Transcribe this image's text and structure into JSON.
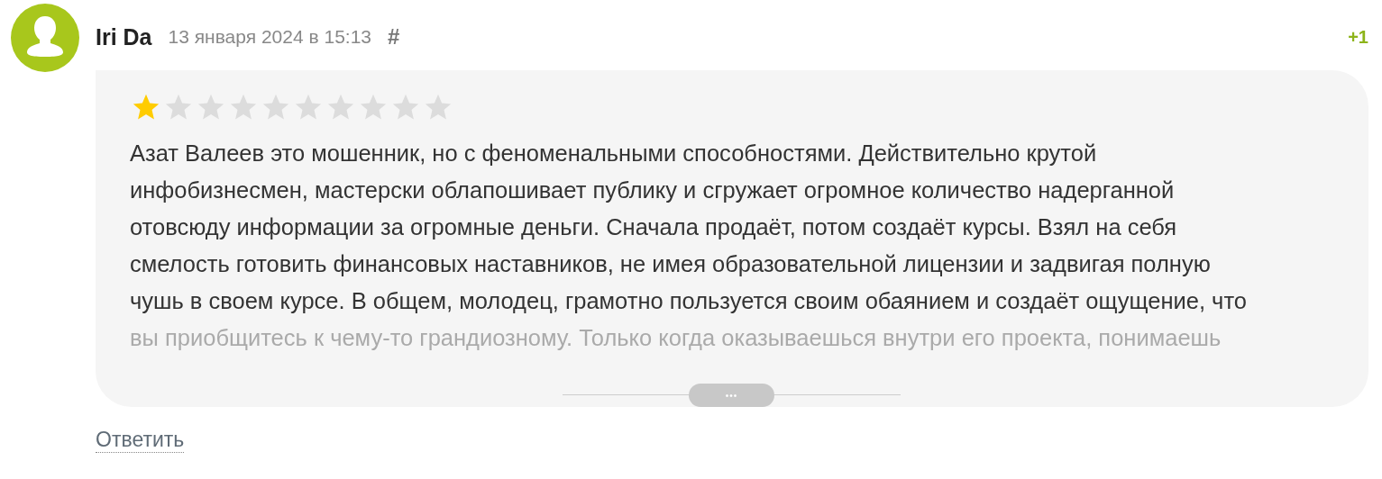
{
  "comment": {
    "author": "Iri Da",
    "date": "13 января 2024 в 15:13",
    "anchor": "#",
    "score": "+1",
    "stars": 1,
    "text_lines": [
      "Азат Валеев это мошенник, но с феноменальными способностями. Действительно крутой",
      "инфобизнесмен, мастерски облапошивает публику и сгружает огромное количество надерганной",
      "отовсюду информации за огромные деньги. Сначала продаёт, потом создаёт курсы. Взял на себя",
      "смелость готовить финансовых наставников, не имея образовательной лицензии и задвигая полную",
      "чушь в своем курсе. В общем, молодец, грамотно пользуется своим обаянием и создаёт ощущение, что",
      "вы приобщитесь к чему-то грандиозному. Только когда оказываешься внутри его проекта, понимаешь"
    ],
    "expand": "•••",
    "reply": "Ответить"
  }
}
